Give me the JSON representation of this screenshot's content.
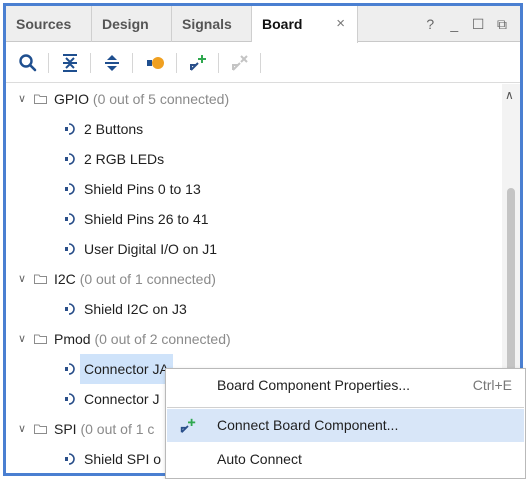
{
  "tabs": [
    {
      "label": "Sources",
      "active": false
    },
    {
      "label": "Design",
      "active": false
    },
    {
      "label": "Signals",
      "active": false
    },
    {
      "label": "Board",
      "active": true
    }
  ],
  "tab_close_glyph": "×",
  "window_controls": {
    "help": "?",
    "minimize": "_",
    "maximize": "☐",
    "float": "⧉"
  },
  "toolbar": {
    "icons": [
      "search-icon",
      "collapse-all-icon",
      "expand-all-icon",
      "auto-connect-icon",
      "connect-component-icon",
      "disconnect-component-icon"
    ]
  },
  "tree": {
    "groups": [
      {
        "name": "GPIO",
        "status": "(0 out of 5 connected)",
        "items": [
          "2 Buttons",
          "2 RGB LEDs",
          "Shield Pins 0 to 13",
          "Shield Pins 26 to 41",
          "User Digital I/O on J1"
        ]
      },
      {
        "name": "I2C",
        "status": "(0 out of 1 connected)",
        "items": [
          "Shield I2C on J3"
        ]
      },
      {
        "name": "Pmod",
        "status": "(0 out of 2 connected)",
        "items": [
          "Connector JA",
          "Connector J"
        ]
      },
      {
        "name": "SPI",
        "status": "(0 out of 1 c",
        "items": [
          "Shield SPI o"
        ]
      }
    ],
    "selected_item": "Connector JA"
  },
  "context_menu": {
    "items": [
      {
        "label": "Board Component Properties...",
        "shortcut": "Ctrl+E",
        "highlighted": false
      },
      {
        "label": "Connect Board Component...",
        "shortcut": "",
        "highlighted": true
      },
      {
        "label": "Auto Connect",
        "shortcut": "",
        "highlighted": false
      }
    ]
  },
  "colors": {
    "panel_border": "#4a7fd1",
    "selection": "#cfe3fa",
    "menu_highlight": "#d8e6f8",
    "accent_green": "#2fa84f",
    "accent_orange": "#f0a020"
  }
}
